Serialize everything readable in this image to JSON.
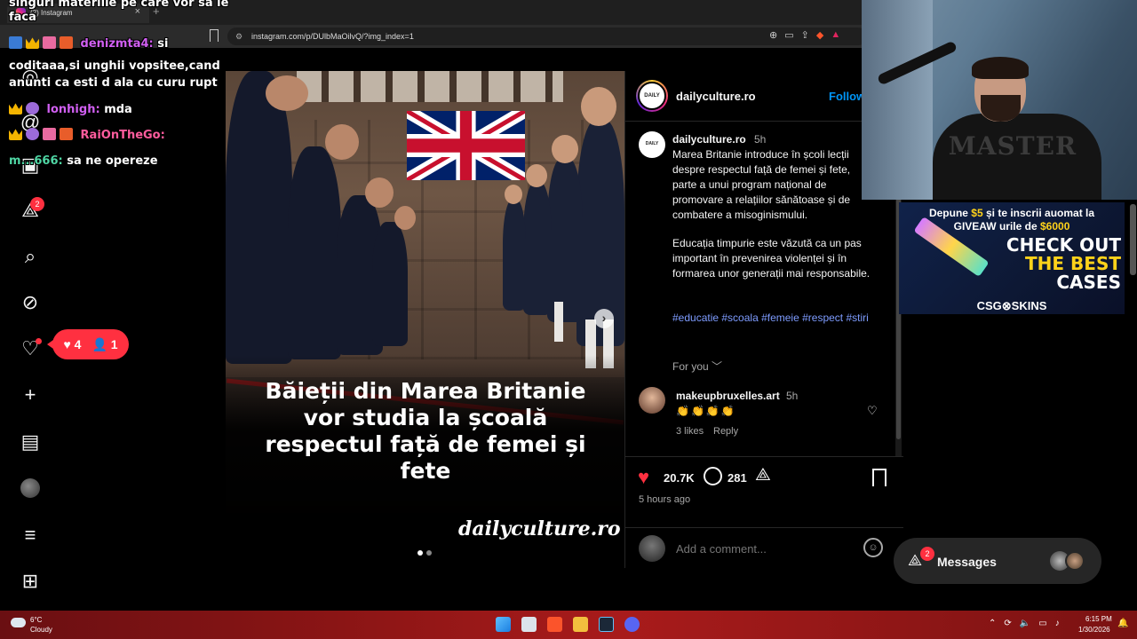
{
  "browser": {
    "tab_title": "(2) Instagram",
    "url": "instagram.com/p/DUlbMaOilvQ/?img_index=1"
  },
  "nav": {
    "messages_badge": "2",
    "notifications_popup": {
      "likes": "4",
      "followers": "1"
    }
  },
  "chat": {
    "lines": [
      {
        "text": "singuri materiile pe care vor sa le"
      },
      {
        "text": "faca"
      },
      {
        "user": "denizmta4:",
        "user_color": "#d15ff2",
        "text": "si"
      },
      {
        "text": "coditaaa,si unghii vopsitee,cand"
      },
      {
        "text": "anunti ca esti d ala cu curu rupt"
      },
      {
        "user": "lonhigh:",
        "user_color": "#d15ff2",
        "text": "mda"
      },
      {
        "user": "RaiOnTheGo:",
        "user_color": "#ff5c9d",
        "text": ""
      },
      {
        "user": "m...666:",
        "user_color": "#4fd6a4",
        "text": "sa ne opereze"
      }
    ]
  },
  "post": {
    "headline": "Băieții din Marea Britanie vor studia la școală respectul față de femei și fete",
    "watermark": "dailyculture.ro"
  },
  "account": {
    "avatar_text": "DAILY",
    "username": "dailyculture.ro",
    "follow_label": "Follow"
  },
  "caption": {
    "username": "dailyculture.ro",
    "time": "5h",
    "paragraph1": "Marea Britanie introduce în școli lecții despre respectul față de femei și fete, parte a unui program național de promovare a relațiilor sănătoase și de combatere a misoginismului.",
    "paragraph2": "Educația timpurie este văzută ca un pas important în prevenirea violenței și în formarea unor generații mai responsabile.",
    "hashtags": "#educatie #scoala #femeie #respect #stiri",
    "for_you": "For you"
  },
  "comment": {
    "username": "makeupbruxelles.art",
    "time": "5h",
    "text": "👏👏👏👏",
    "likes": "3 likes",
    "reply_label": "Reply"
  },
  "actions": {
    "likes_count": "20.7K",
    "comments_count": "281",
    "posted_ago": "5 hours ago",
    "add_comment_placeholder": "Add a comment..."
  },
  "ad": {
    "line1_a": "Depune",
    "line1_b": "$5",
    "line1_c": "și te inscrii auomat la",
    "line2_a": "GIVEAW",
    "line2_b": "urile de",
    "line2_c": "$6000",
    "headline_1": "CHECK OUT",
    "headline_2": "THE BEST",
    "headline_3": "CASES",
    "brand": "CSG⊗SKINS"
  },
  "webcam": {
    "shirt_text": "MASTER"
  },
  "messages": {
    "badge": "2",
    "label": "Messages"
  },
  "taskbar": {
    "temperature": "6°C",
    "weather": "Cloudy",
    "time": "6:15 PM",
    "date": "1/30/2026"
  }
}
